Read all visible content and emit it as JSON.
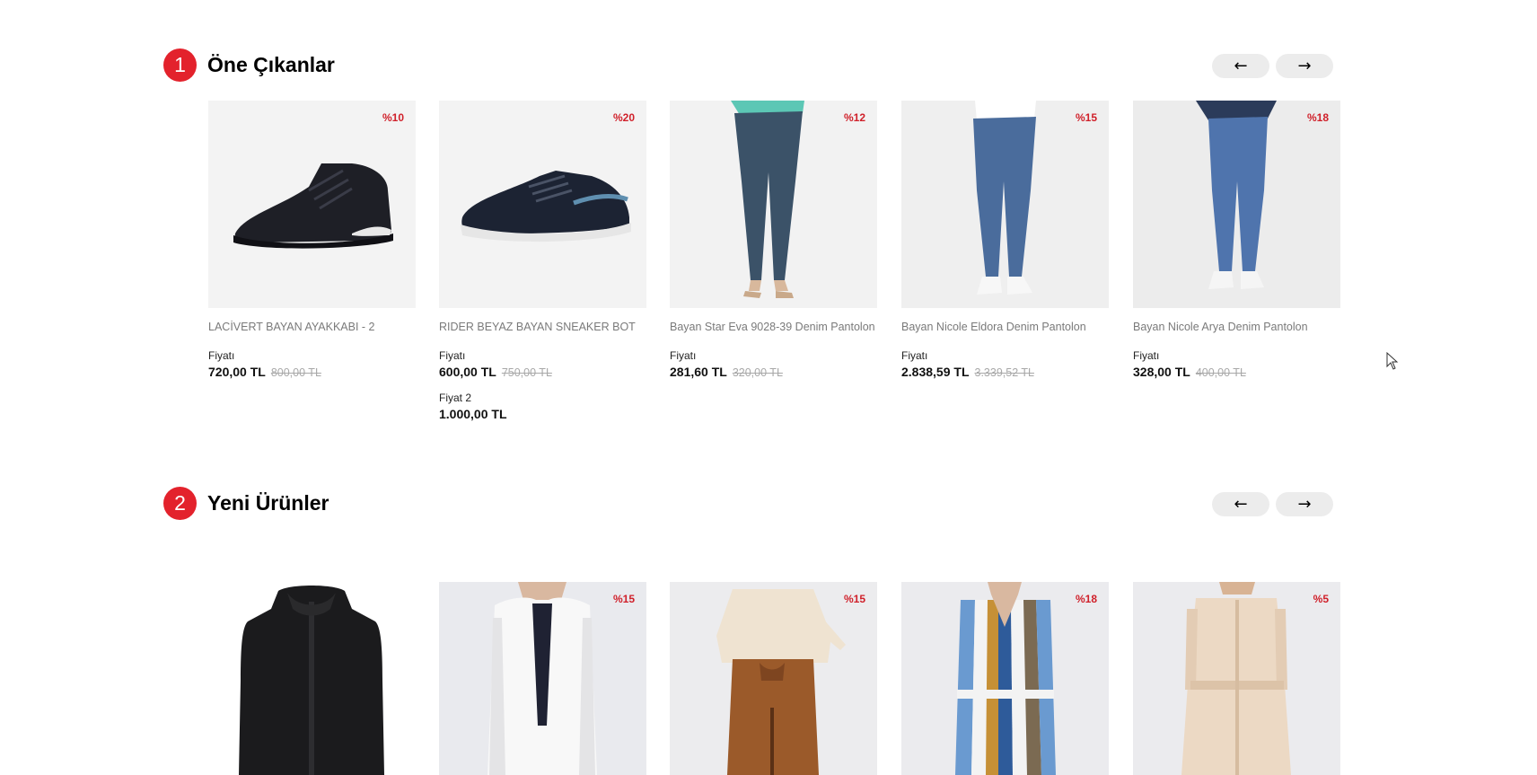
{
  "sections": [
    {
      "number": "1",
      "title": "Öne Çıkanlar",
      "prev_icon": "arrow-left-icon",
      "next_icon": "arrow-right-icon",
      "prev_label": "←",
      "next_label": "→",
      "products": [
        {
          "name": "LACİVERT BAYAN AYAKKABI - 2",
          "discount": "%10",
          "price_label": "Fiyatı",
          "price": "720,00 TL",
          "old_price": "800,00 TL",
          "image": "sneaker-boot-black"
        },
        {
          "name": "RIDER BEYAZ BAYAN SNEAKER BOT",
          "discount": "%20",
          "price_label": "Fiyatı",
          "price": "600,00 TL",
          "old_price": "750,00 TL",
          "price2_label": "Fiyat 2",
          "price2": "1.000,00 TL",
          "image": "sneaker-navy"
        },
        {
          "name": "Bayan Star Eva 9028-39 Denim Pantolon",
          "discount": "%12",
          "price_label": "Fiyatı",
          "price": "281,60 TL",
          "old_price": "320,00 TL",
          "image": "jeans-dark"
        },
        {
          "name": "Bayan Nicole Eldora Denim Pantolon",
          "discount": "%15",
          "price_label": "Fiyatı",
          "price": "2.838,59 TL",
          "old_price": "3.339,52 TL",
          "image": "jeans-medium"
        },
        {
          "name": "Bayan Nicole Arya Denim Pantolon",
          "discount": "%18",
          "price_label": "Fiyatı",
          "price": "328,00 TL",
          "old_price": "400,00 TL",
          "image": "jeans-blue"
        }
      ]
    },
    {
      "number": "2",
      "title": "Yeni Ürünler",
      "prev_icon": "arrow-left-icon",
      "next_icon": "arrow-right-icon",
      "prev_label": "←",
      "next_label": "→",
      "products": [
        {
          "discount": "",
          "image": "black-jacket"
        },
        {
          "discount": "%15",
          "image": "white-blazer"
        },
        {
          "discount": "%15",
          "image": "brown-skirt"
        },
        {
          "discount": "%18",
          "image": "striped-dress"
        },
        {
          "discount": "%5",
          "image": "beige-dress"
        }
      ]
    }
  ],
  "colors": {
    "accent": "#e3222c",
    "discount": "#d0202a",
    "image_bg": "#f3f3f3",
    "button_bg": "#ececec",
    "old_price": "#a8a8a8"
  }
}
